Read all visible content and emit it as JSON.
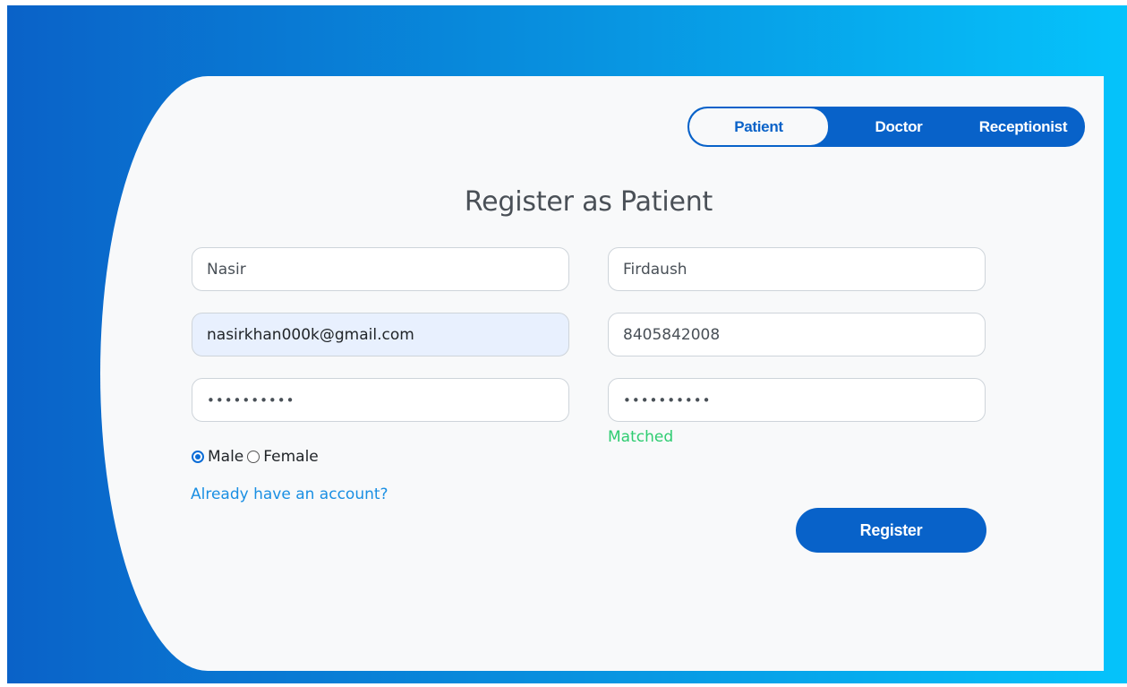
{
  "tabs": {
    "patient": "Patient",
    "doctor": "Doctor",
    "receptionist": "Receptionist",
    "active": "Patient"
  },
  "form": {
    "title": "Register as Patient",
    "first_name": "Nasir",
    "last_name": "Firdaush",
    "email": "nasirkhan000k@gmail.com",
    "phone": "8405842008",
    "password": "••••••••••",
    "confirm_password": "••••••••••",
    "match_status": "Matched",
    "gender": {
      "male_label": "Male",
      "female_label": "Female",
      "selected": "Male"
    },
    "login_link": "Already have an account?",
    "register_label": "Register"
  },
  "colors": {
    "primary": "#0862c9",
    "gradient_start": "#0a62c8",
    "gradient_end": "#05c3fb",
    "match_status": "#2ecc71",
    "link": "#1a8fe3"
  }
}
